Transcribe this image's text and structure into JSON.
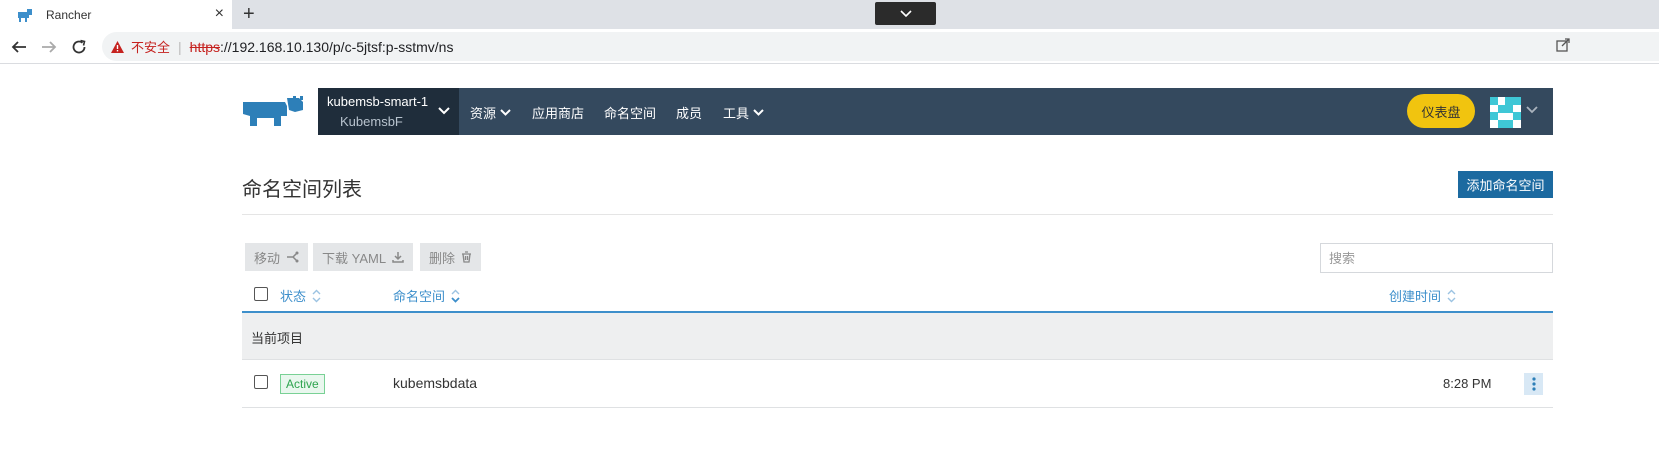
{
  "browser": {
    "tab_title": "Rancher",
    "tab_close": "×",
    "new_tab": "+",
    "security_warning": "不安全",
    "url_scheme": "https",
    "url_rest": "://192.168.10.130/p/c-5jtsf:p-sstmv/ns"
  },
  "header": {
    "cluster_name": "kubemsb-smart-1",
    "project_name": "KubemsbF",
    "nav": [
      {
        "label": "资源",
        "has_dropdown": true
      },
      {
        "label": "应用商店",
        "has_dropdown": false
      },
      {
        "label": "命名空间",
        "has_dropdown": false
      },
      {
        "label": "成员",
        "has_dropdown": false
      },
      {
        "label": "工具",
        "has_dropdown": true
      }
    ],
    "dashboard_label": "仪表盘"
  },
  "page": {
    "title": "命名空间列表",
    "add_button": "添加命名空间"
  },
  "bulk_actions": {
    "move": "移动",
    "download": "下载 YAML",
    "delete": "删除"
  },
  "search": {
    "placeholder": "搜索",
    "value": ""
  },
  "table": {
    "columns": [
      "状态",
      "命名空间",
      "创建时间"
    ],
    "group_label": "当前项目",
    "rows": [
      {
        "status": "Active",
        "namespace": "kubemsbdata",
        "created": "8:28 PM"
      }
    ]
  },
  "colors": {
    "header_bg": "#34495e",
    "cluster_bg": "#1f2d3b",
    "accent_blue": "#3d8fcb",
    "primary_button": "#1c6aa0",
    "dashboard_yellow": "#f1c40f",
    "active_green": "#2ea44f"
  }
}
